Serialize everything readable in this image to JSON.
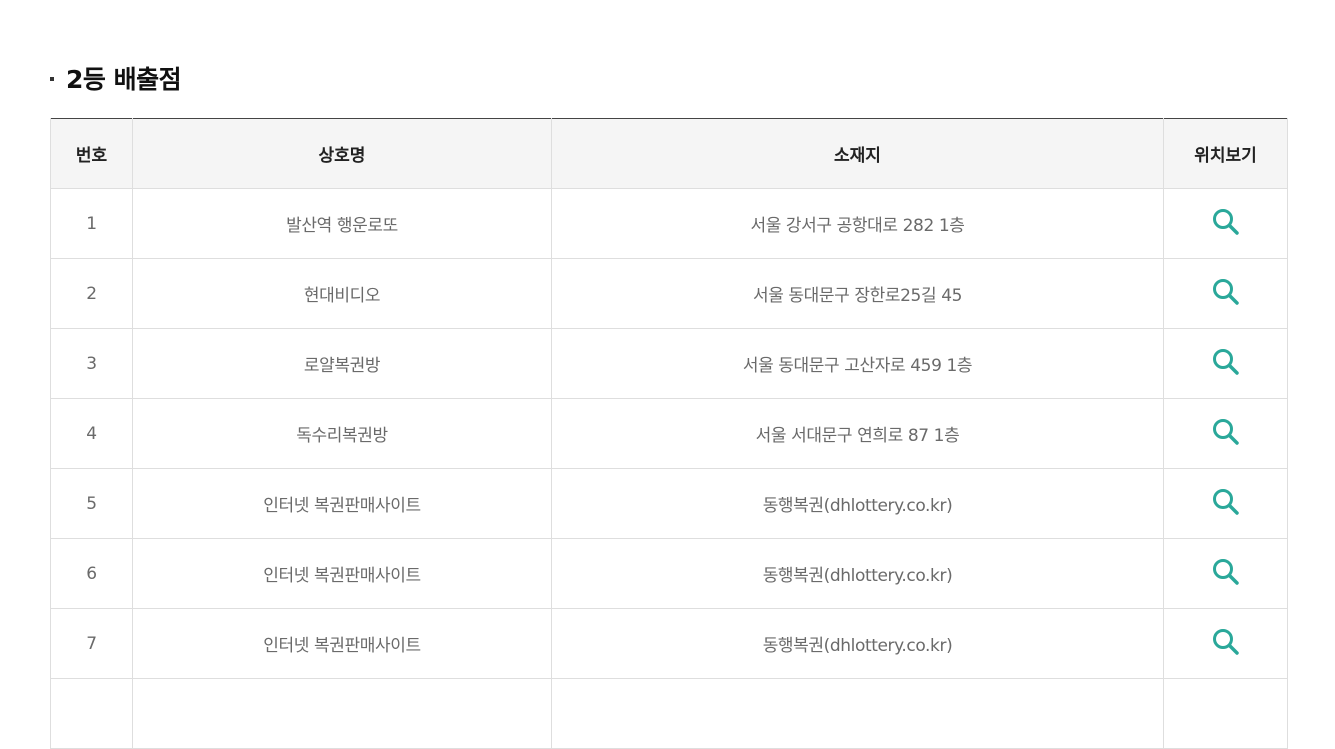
{
  "section": {
    "title": "2등 배출점"
  },
  "table": {
    "headers": {
      "number": "번호",
      "store_name": "상호명",
      "address": "소재지",
      "map": "위치보기"
    },
    "rows": [
      {
        "number": "1",
        "store_name": "발산역 행운로또",
        "address": "서울 강서구 공항대로 282 1층",
        "map_icon": "search-icon"
      },
      {
        "number": "2",
        "store_name": "현대비디오",
        "address": "서울 동대문구 장한로25길 45",
        "map_icon": "search-icon"
      },
      {
        "number": "3",
        "store_name": "로얄복권방",
        "address": "서울 동대문구 고산자로 459 1층",
        "map_icon": "search-icon"
      },
      {
        "number": "4",
        "store_name": "독수리복권방",
        "address": "서울 서대문구 연희로 87 1층",
        "map_icon": "search-icon"
      },
      {
        "number": "5",
        "store_name": "인터넷 복권판매사이트",
        "address": "동행복권(dhlottery.co.kr)",
        "map_icon": "search-icon"
      },
      {
        "number": "6",
        "store_name": "인터넷 복권판매사이트",
        "address": "동행복권(dhlottery.co.kr)",
        "map_icon": "search-icon"
      },
      {
        "number": "7",
        "store_name": "인터넷 복권판매사이트",
        "address": "동행복권(dhlottery.co.kr)",
        "map_icon": "search-icon"
      },
      {
        "number": "",
        "store_name": "",
        "address": "",
        "map_icon": ""
      }
    ]
  },
  "colors": {
    "accent_icon": "#2aa89a",
    "header_bg": "#f5f5f5",
    "border": "#dedede",
    "top_border": "#444444",
    "cell_text": "#6a6a6a"
  }
}
